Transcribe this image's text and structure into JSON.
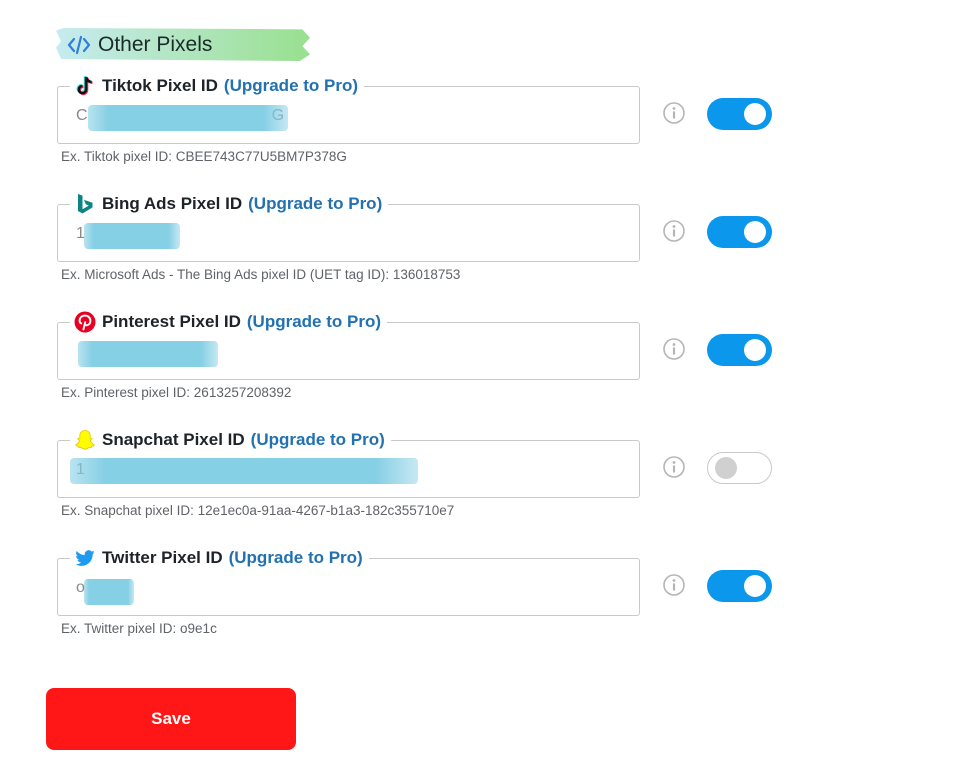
{
  "section": {
    "title": "Other Pixels"
  },
  "pixels": [
    {
      "label": "Tiktok Pixel ID",
      "pro": "(Upgrade to Pro)",
      "value_start": "C",
      "value_end": "G",
      "hint": "Ex. Tiktok pixel ID: CBEE743C77U5BM7P378G",
      "enabled": true,
      "icon": "tiktok-icon"
    },
    {
      "label": "Bing Ads Pixel ID",
      "pro": "(Upgrade to Pro)",
      "value_start": "1",
      "value_end": "",
      "hint": "Ex. Microsoft Ads - The Bing Ads pixel ID (UET tag ID): 136018753",
      "enabled": true,
      "icon": "bing-icon"
    },
    {
      "label": "Pinterest Pixel ID",
      "pro": "(Upgrade to Pro)",
      "value_start": "",
      "value_end": "",
      "hint": "Ex. Pinterest pixel ID: 2613257208392",
      "enabled": true,
      "icon": "pinterest-icon"
    },
    {
      "label": "Snapchat Pixel ID",
      "pro": "(Upgrade to Pro)",
      "value_start": "1",
      "value_end": "",
      "hint": "Ex. Snapchat pixel ID: 12e1ec0a-91aa-4267-b1a3-182c355710e7",
      "enabled": false,
      "icon": "snapchat-icon"
    },
    {
      "label": "Twitter Pixel ID",
      "pro": "(Upgrade to Pro)",
      "value_start": "o",
      "value_end": "",
      "hint": "Ex. Twitter pixel ID: o9e1c",
      "enabled": true,
      "icon": "twitter-icon"
    }
  ],
  "save_label": "Save",
  "colors": {
    "accent": "#0a97ec",
    "link": "#2271b1",
    "save": "#ff1616"
  }
}
